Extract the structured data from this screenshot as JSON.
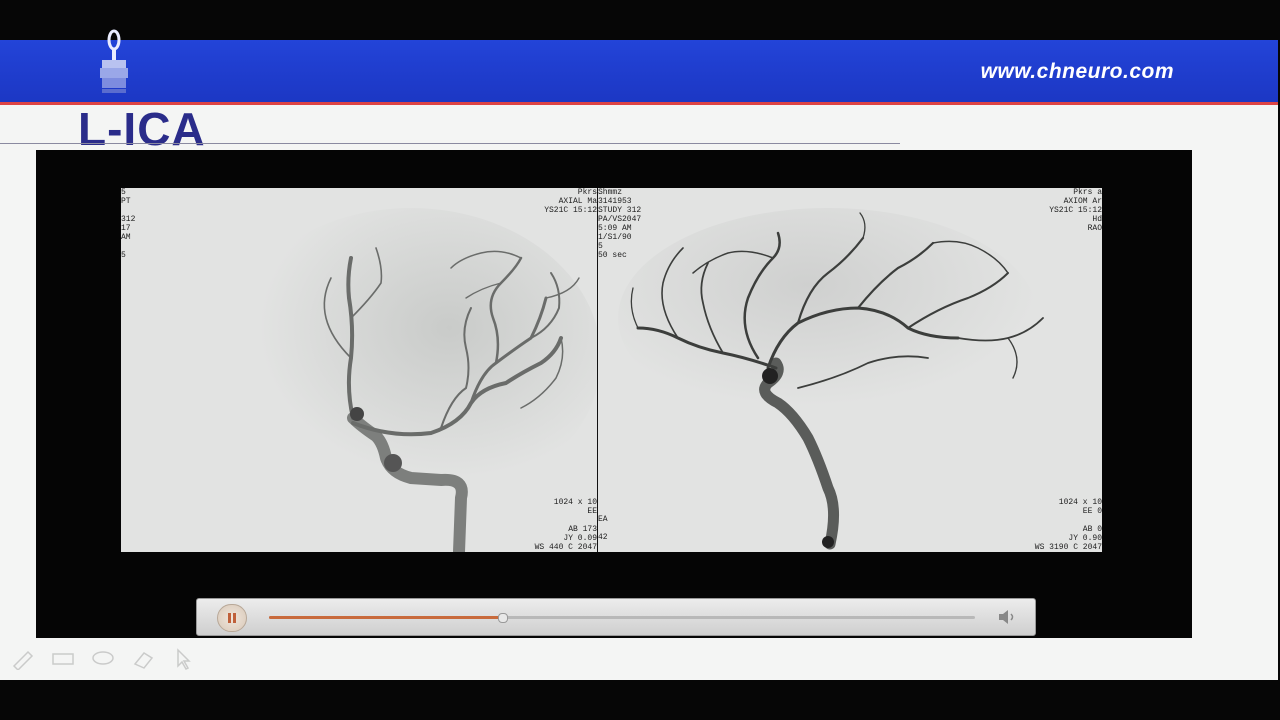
{
  "slide": {
    "site_url": "www.chneuro.com",
    "title": "L-ICA"
  },
  "player": {
    "left_frame": {
      "overlay_top_left": "5\nPT\n\n312\n17\nAM\n\n5",
      "overlay_top_right": "Pkrs\nAXIAL Ma\nYS21C 15:12",
      "overlay_bottom_right": "1024 x 10\nEE\n\nAB 173\nJY 0.09\nWS 440 C 2047"
    },
    "right_frame": {
      "overlay_top_left": "Shmmz\n3141953\nSTUDY 312\nPA/VS2047\n5:09 AM\n1/S1/90\n5\n50 sec",
      "overlay_top_right": "Pkrs a\nAXIOM Ar\nYS21C 15:12\nHd\nRAO",
      "overlay_bottom_left": "EA\n\n42",
      "overlay_bottom_right": "1024 x 10\nEE 0\n\nAB 0\nJY 0.90\nWS 3190 C 2047"
    },
    "progress": 0.33,
    "state": "playing"
  },
  "icons": {
    "pause": "pause-icon",
    "volume": "volume-icon",
    "tools": [
      "pen-icon",
      "highlighter-icon",
      "lasso-icon",
      "eraser-icon",
      "pointer-icon"
    ]
  },
  "colors": {
    "header_blue": "#1f3ccf",
    "title_navy": "#2a2c8a",
    "accent_red": "#d44444",
    "progress_orange": "#c86a3c"
  }
}
